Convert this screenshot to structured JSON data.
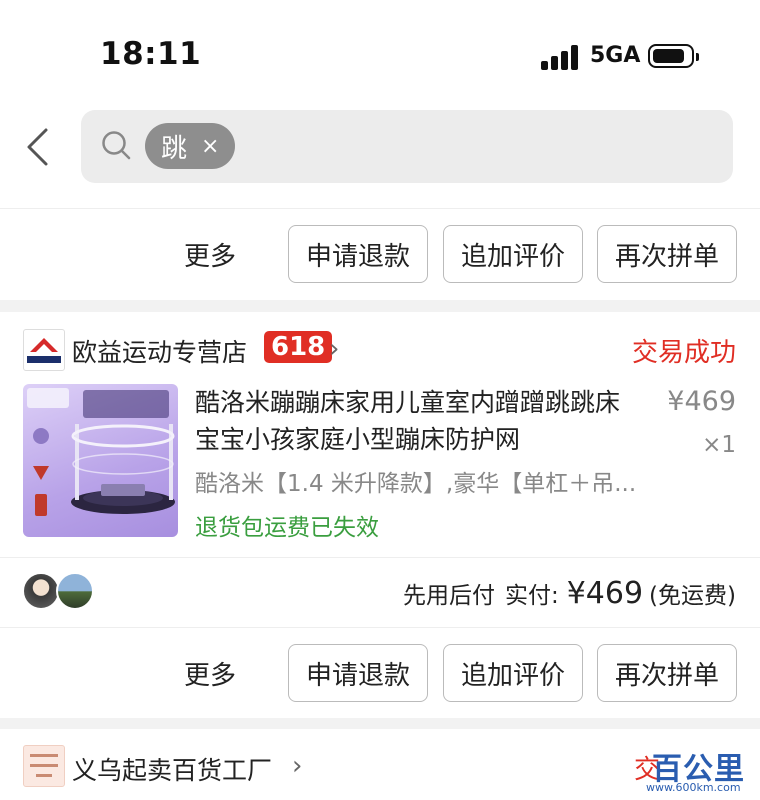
{
  "status_bar": {
    "time": "18:11",
    "network": "5GA"
  },
  "search": {
    "keyword_chip": "跳",
    "chip_close": "×"
  },
  "prev_order": {
    "actions": {
      "more": "更多",
      "refund": "申请退款",
      "review": "追加评价",
      "reorder": "再次拼单"
    }
  },
  "order": {
    "shop_name": "欧益运动专营店",
    "shop_badge": "618",
    "chevron": "›",
    "status": "交易成功",
    "product_title": "酷洛米蹦蹦床家用儿童室内蹭蹭跳跳床宝宝小孩家庭小型蹦床防护网",
    "price": "¥469",
    "quantity": "×1",
    "spec": "酷洛米【1.4 米升降款】,豪华【单杠＋吊...",
    "return_notice": "退货包运费已失效",
    "payment": {
      "method": "先用后付",
      "label": "实付:",
      "amount": "¥469",
      "note": "(免运费)"
    },
    "actions": {
      "more": "更多",
      "refund": "申请退款",
      "review": "追加评价",
      "reorder": "再次拼单"
    }
  },
  "next_order": {
    "shop_name": "义乌起卖百货工厂",
    "chevron": "›",
    "status_partial": "交"
  },
  "watermark": {
    "text": "百公里",
    "url": "www.600km.com"
  },
  "colors": {
    "accent_red": "#e02e24",
    "green": "#3a9e3f",
    "gray_text": "#888888"
  },
  "icons": [
    "back-icon",
    "search-icon",
    "signal-icon",
    "battery-icon",
    "close-icon",
    "chevron-right-icon"
  ]
}
